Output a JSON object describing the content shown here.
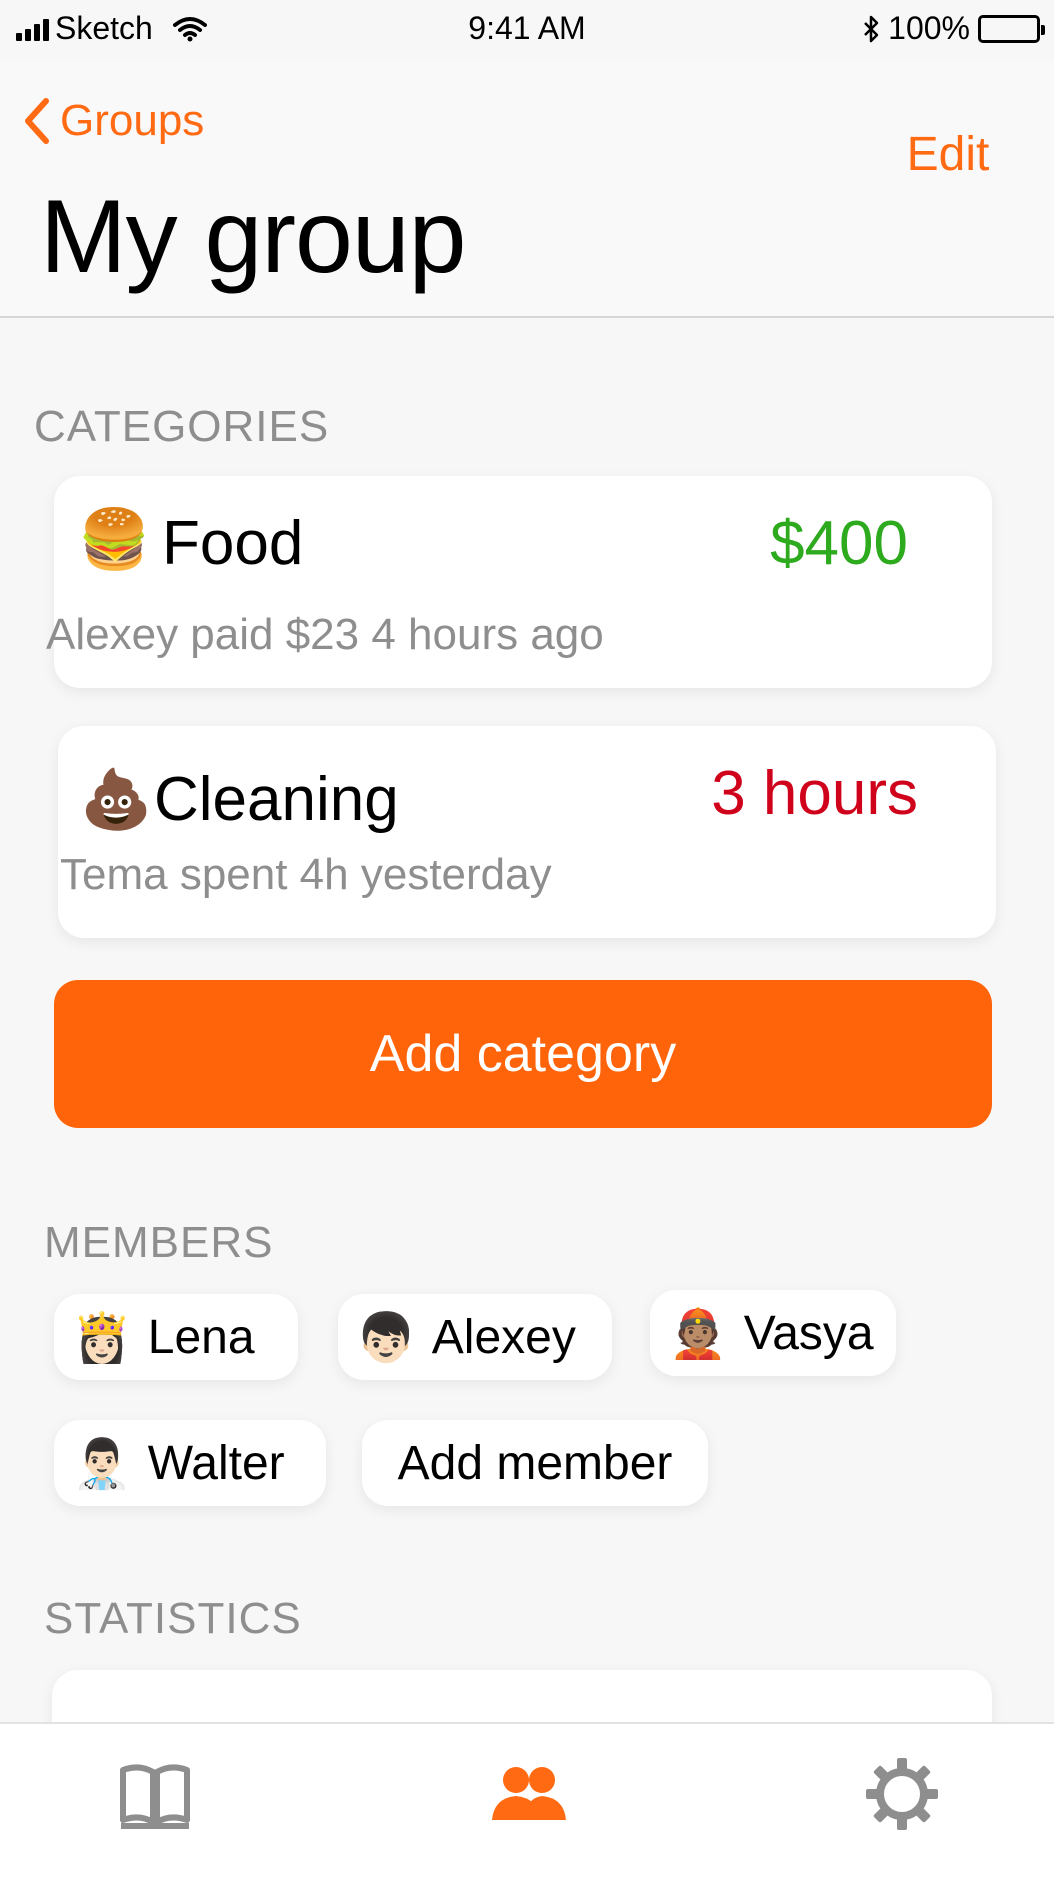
{
  "status_bar": {
    "carrier": "Sketch",
    "time": "9:41 AM",
    "battery": "100%"
  },
  "nav": {
    "back_label": "Groups",
    "edit_label": "Edit",
    "title": "My group"
  },
  "categories": {
    "header": "CATEGORIES",
    "items": [
      {
        "emoji": "🍔",
        "name": "Food",
        "value": "$400",
        "value_color": "#2eaa1e",
        "subtitle": "Alexey paid $23 4 hours ago"
      },
      {
        "emoji": "💩",
        "name": "Cleaning",
        "value": "3 hours",
        "value_color": "#d0021b",
        "subtitle": "Tema spent 4h yesterday"
      }
    ],
    "add_label": "Add category"
  },
  "members": {
    "header": "MEMBERS",
    "items": [
      {
        "emoji": "👸🏻",
        "name": "Lena"
      },
      {
        "emoji": "👦🏻",
        "name": "Alexey"
      },
      {
        "emoji": "👲🏽",
        "name": "Vasya"
      },
      {
        "emoji": "👨🏻‍⚕️",
        "name": "Walter"
      }
    ],
    "add_label": "Add member"
  },
  "statistics": {
    "header": "STATISTICS"
  },
  "tabs": [
    {
      "icon": "book-icon",
      "active": false
    },
    {
      "icon": "group-icon",
      "active": true
    },
    {
      "icon": "gear-icon",
      "active": false
    }
  ],
  "colors": {
    "accent": "#ff6a13",
    "button": "#ff640a",
    "muted": "#8e8e8e",
    "positive": "#2eaa1e",
    "negative": "#d0021b"
  }
}
